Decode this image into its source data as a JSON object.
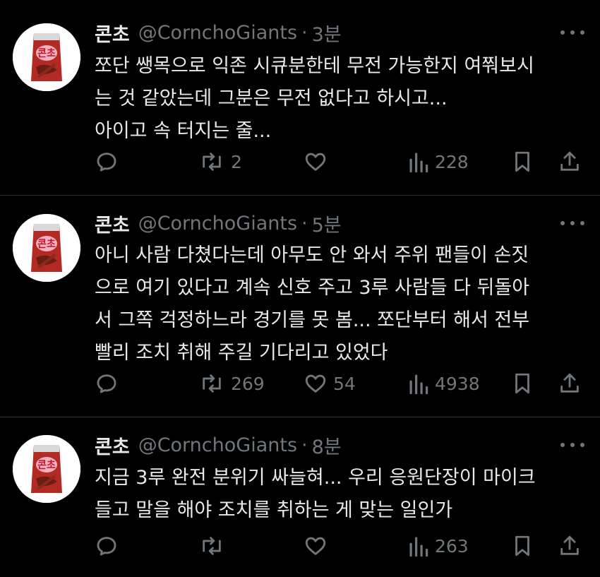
{
  "colors": {
    "background": "#000000",
    "text": "#e7e9ea",
    "muted": "#71767b",
    "divider": "#2f3336",
    "avatar_bag": "#c0392b"
  },
  "icons": {
    "reply": "speech-bubble-icon",
    "repost": "repost-arrows-icon",
    "like": "heart-icon",
    "views": "bar-chart-icon",
    "bookmark": "bookmark-icon",
    "share": "share-upload-icon",
    "more": "more-dots-icon"
  },
  "tweets": [
    {
      "name": "콘초",
      "handle": "@CornchoGiants",
      "separator": "·",
      "time": "3분",
      "lines": [
        "쪼단 쌩목으로 익존 시큐분한테 무전 가능한지 여쭤보시",
        "는 것 같았는데 그분은 무전 없다고 하시고...",
        "아이고 속 터지는 줄..."
      ],
      "reposts": "2",
      "likes": "",
      "views": "228"
    },
    {
      "name": "콘초",
      "handle": "@CornchoGiants",
      "separator": "·",
      "time": "5분",
      "lines": [
        "아니 사람 다쳤다는데 아무도 안 와서 주위 팬들이 손짓",
        "으로 여기 있다고 계속 신호 주고 3루 사람들 다 뒤돌아",
        "서 그쪽 걱정하느라 경기를 못 봄... 쪼단부터 해서 전부",
        "빨리 조치 취해 주길 기다리고 있었다"
      ],
      "reposts": "269",
      "likes": "54",
      "views": "4938"
    },
    {
      "name": "콘초",
      "handle": "@CornchoGiants",
      "separator": "·",
      "time": "8분",
      "lines": [
        "지금 3루 완전 분위기 싸늘혀... 우리 응원단장이 마이크",
        "들고 말을 해야 조치를 취하는 게 맞는 일인가"
      ],
      "reposts": "",
      "likes": "",
      "views": "263"
    }
  ]
}
